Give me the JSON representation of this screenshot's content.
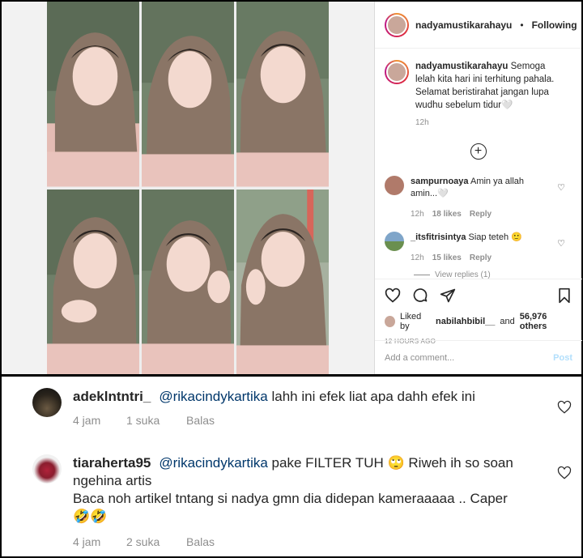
{
  "post": {
    "username": "nadyamustikarahayu",
    "dot": "•",
    "following": "Following",
    "more": "•••",
    "caption_user": "nadyamustikarahayu",
    "caption_text": "Semoga lelah kita hari ini terhitung pahala. Selamat beristirahat jangan lupa wudhu sebelum tidur🤍",
    "caption_time": "12h",
    "comments": [
      {
        "user": "sampurnoaya",
        "text": "Amin ya allah amin...🤍",
        "time": "12h",
        "likes": "18 likes",
        "reply": "Reply"
      },
      {
        "user": "_itsfitrisintya",
        "text": "Siap teteh 🙂",
        "time": "12h",
        "likes": "15 likes",
        "reply": "Reply"
      }
    ],
    "view_replies": "View replies (1)",
    "liked_by_prefix": "Liked by",
    "liked_by_user": "nabilahbibil__",
    "liked_by_and": "and",
    "liked_by_others": "56,976 others",
    "posted_ago": "12 HOURS AGO",
    "add_comment_placeholder": "Add a comment...",
    "post_button": "Post"
  },
  "bottom_comments": [
    {
      "user": "adeklntntri_",
      "mention": "@rikacindykartika",
      "text": "lahh ini efek liat apa dahh efek ini",
      "time": "4 jam",
      "likes": "1 suka",
      "reply": "Balas"
    },
    {
      "user": "tiaraherta95",
      "mention": "@rikacindykartika",
      "text": "pake FILTER TUH 🙄 Riweh ih so soan ngehina artis",
      "text2": "Baca noh artikel tntang si nadya gmn dia didepan kameraaaaa .. Caper",
      "text3": "🤣🤣",
      "time": "4 jam",
      "likes": "2 suka",
      "reply": "Balas"
    }
  ],
  "colors": {
    "hijab": "#8a7566",
    "shirt": "#e9c3bc",
    "skin": "#f3d9cf",
    "link": "#00376b",
    "muted": "#8e8e8e"
  }
}
